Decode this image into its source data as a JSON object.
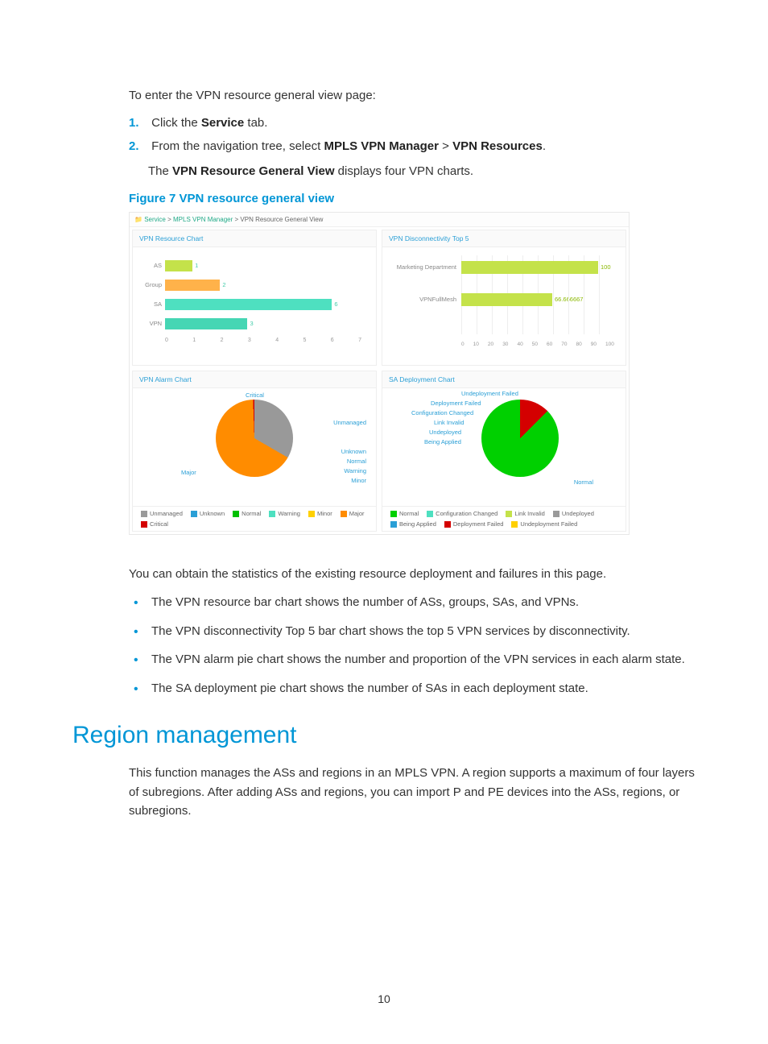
{
  "intro": "To enter the VPN resource general view page:",
  "steps": [
    {
      "num": "1.",
      "pre": "Click the ",
      "bold": "Service",
      "post": " tab."
    },
    {
      "num": "2.",
      "pre": "From the navigation tree, select ",
      "bold": "MPLS VPN Manager",
      "mid": " > ",
      "bold2": "VPN Resources",
      "post": "."
    }
  ],
  "subline": {
    "pre": "The ",
    "bold": "VPN Resource General View",
    "post": " displays four VPN charts."
  },
  "figure_caption": "Figure 7 VPN resource general view",
  "breadcrumb": {
    "a": "Service",
    "sep": " > ",
    "b": "MPLS VPN Manager",
    "c": "VPN Resource General View"
  },
  "panels": {
    "resource": "VPN Resource Chart",
    "disconnect": "VPN Disconnectivity Top 5",
    "alarm": "VPN Alarm Chart",
    "deploy": "SA Deployment Chart"
  },
  "chart_data": [
    {
      "id": "vpn_resource",
      "type": "bar",
      "orientation": "horizontal",
      "title": "VPN Resource Chart",
      "categories": [
        "AS",
        "Group",
        "SA",
        "VPN"
      ],
      "values": [
        1,
        2,
        6,
        3
      ],
      "colors": [
        "#c4e24a",
        "#ffb24a",
        "#4ee0c0",
        "#46d6b4"
      ],
      "xlim": [
        0,
        7
      ],
      "xticks": [
        0,
        1,
        2,
        3,
        4,
        5,
        6,
        7
      ]
    },
    {
      "id": "vpn_disconnect_top5",
      "type": "bar",
      "orientation": "horizontal",
      "title": "VPN Disconnectivity Top 5",
      "categories": [
        "Marketing Department",
        "VPNFullMesh"
      ],
      "values": [
        100,
        66.666667
      ],
      "color": "#c4e24a",
      "xlim": [
        0,
        100
      ],
      "xticks": [
        0,
        10,
        20,
        30,
        40,
        50,
        60,
        70,
        80,
        90,
        100
      ]
    },
    {
      "id": "vpn_alarm",
      "type": "pie",
      "title": "VPN Alarm Chart",
      "series": [
        {
          "name": "Unmanaged",
          "value": 33,
          "color": "#9a9a9a"
        },
        {
          "name": "Unknown",
          "value": 0,
          "color": "#2a9fd6"
        },
        {
          "name": "Normal",
          "value": 0,
          "color": "#00c000"
        },
        {
          "name": "Warning",
          "value": 0,
          "color": "#4ee0c0"
        },
        {
          "name": "Minor",
          "value": 0,
          "color": "#ffd000"
        },
        {
          "name": "Major",
          "value": 66,
          "color": "#ff8c00"
        },
        {
          "name": "Critical",
          "value": 1,
          "color": "#d40000"
        }
      ],
      "callouts": [
        "Critical",
        "Unmanaged",
        "Unknown",
        "Normal",
        "Warning",
        "Minor",
        "Major"
      ]
    },
    {
      "id": "sa_deployment",
      "type": "pie",
      "title": "SA Deployment Chart",
      "series": [
        {
          "name": "Normal",
          "value": 87,
          "color": "#00d000"
        },
        {
          "name": "Configuration Changed",
          "value": 0,
          "color": "#4ee0c0"
        },
        {
          "name": "Link Invalid",
          "value": 0,
          "color": "#c4e24a"
        },
        {
          "name": "Undeployed",
          "value": 0,
          "color": "#9a9a9a"
        },
        {
          "name": "Being Applied",
          "value": 0,
          "color": "#2a9fd6"
        },
        {
          "name": "Deployment Failed",
          "value": 13,
          "color": "#d40000"
        },
        {
          "name": "Undeployment Failed",
          "value": 0,
          "color": "#ffd000"
        }
      ],
      "callouts": [
        "Undeployment Failed",
        "Deployment Failed",
        "Configuration Changed",
        "Link Invalid",
        "Undeployed",
        "Being Applied",
        "Normal"
      ]
    }
  ],
  "after_fig": "You can obtain the statistics of the existing resource deployment and failures in this page.",
  "bullets": [
    "The VPN resource bar chart shows the number of ASs, groups, SAs, and VPNs.",
    "The VPN disconnectivity Top 5 bar chart shows the top 5 VPN services by disconnectivity.",
    "The VPN alarm pie chart shows the number and proportion of the VPN services in each alarm state.",
    "The SA deployment pie chart shows the number of SAs in each deployment state."
  ],
  "section_heading": "Region management",
  "section_body": "This function manages the ASs and regions in an MPLS VPN. A region supports a maximum of four layers of subregions. After adding ASs and regions, you can import P and PE devices into the ASs, regions, or subregions.",
  "page_number": "10"
}
